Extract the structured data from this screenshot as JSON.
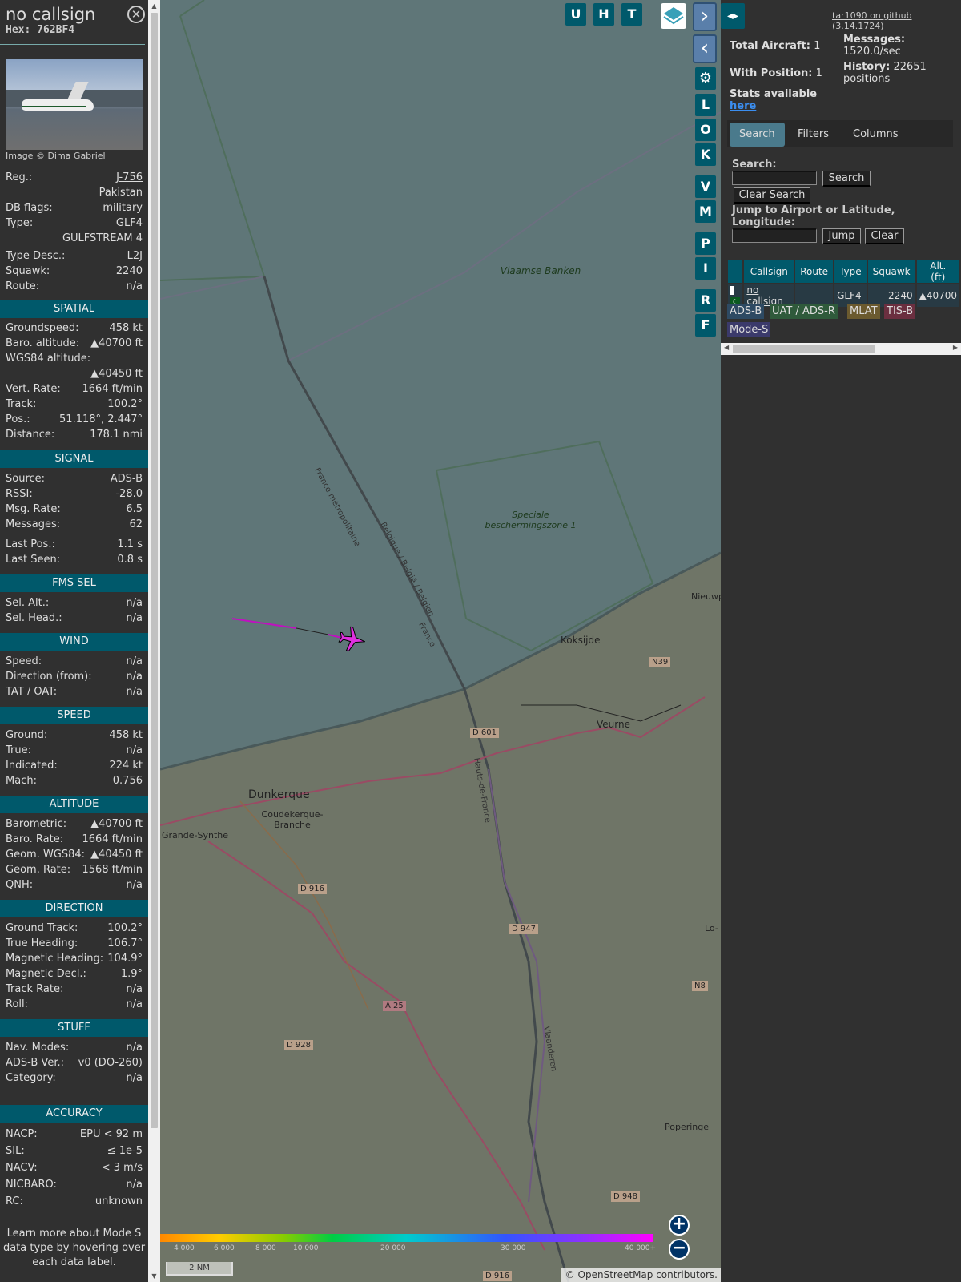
{
  "info": {
    "callsign": "no callsign",
    "hex": "Hex: 762BF4",
    "image_credit": "Image © Dima Gabriel",
    "reg_label": "Reg.:",
    "reg": "J-756",
    "country": "Pakistan",
    "dbflags_label": "DB flags:",
    "dbflags": "military",
    "type_label": "Type:",
    "type": "GLF4",
    "type_full": "GULFSTREAM 4",
    "typedesc_label": "Type Desc.:",
    "typedesc": "L2J",
    "squawk_label": "Squawk:",
    "squawk": "2240",
    "route_label": "Route:",
    "route": "n/a"
  },
  "sections": {
    "spatial": "SPATIAL",
    "signal": "SIGNAL",
    "fms": "FMS SEL",
    "wind": "WIND",
    "speed": "SPEED",
    "altitude": "ALTITUDE",
    "direction": "DIRECTION",
    "stuff": "STUFF",
    "accuracy": "ACCURACY"
  },
  "spatial": [
    [
      "Groundspeed:",
      "458 kt"
    ],
    [
      "Baro. altitude:",
      "▲40700 ft"
    ],
    [
      "WGS84 altitude:",
      ""
    ],
    [
      "",
      "▲40450 ft"
    ],
    [
      "Vert. Rate:",
      "1664 ft/min"
    ],
    [
      "Track:",
      "100.2°"
    ],
    [
      "Pos.:",
      "51.118°, 2.447°"
    ],
    [
      "Distance:",
      "178.1 nmi"
    ]
  ],
  "signal": [
    [
      "Source:",
      "ADS-B"
    ],
    [
      "RSSI:",
      "-28.0"
    ],
    [
      "Msg. Rate:",
      "6.5"
    ],
    [
      "Messages:",
      "62"
    ],
    [
      "Last Pos.:",
      "1.1 s"
    ],
    [
      "Last Seen:",
      "0.8 s"
    ]
  ],
  "fms": [
    [
      "Sel. Alt.:",
      "n/a"
    ],
    [
      "Sel. Head.:",
      "n/a"
    ]
  ],
  "wind": [
    [
      "Speed:",
      "n/a"
    ],
    [
      "Direction (from):",
      "n/a"
    ],
    [
      "TAT / OAT:",
      "n/a"
    ]
  ],
  "speed": [
    [
      "Ground:",
      "458 kt"
    ],
    [
      "True:",
      "n/a"
    ],
    [
      "Indicated:",
      "224 kt"
    ],
    [
      "Mach:",
      "0.756"
    ]
  ],
  "altitude": [
    [
      "Barometric:",
      "▲40700 ft"
    ],
    [
      "Baro. Rate:",
      "1664 ft/min"
    ],
    [
      "Geom. WGS84:",
      "▲40450 ft"
    ],
    [
      "Geom. Rate:",
      "1568 ft/min"
    ],
    [
      "QNH:",
      "n/a"
    ]
  ],
  "direction": [
    [
      "Ground Track:",
      "100.2°"
    ],
    [
      "True Heading:",
      "106.7°"
    ],
    [
      "Magnetic Heading:",
      "104.9°"
    ],
    [
      "Magnetic Decl.:",
      "1.9°"
    ],
    [
      "Track Rate:",
      "n/a"
    ],
    [
      "Roll:",
      "n/a"
    ]
  ],
  "stuff": [
    [
      "Nav. Modes:",
      "n/a"
    ],
    [
      "ADS-B Ver.:",
      "v0 (DO-260)"
    ],
    [
      "Category:",
      "n/a"
    ]
  ],
  "accuracy": [
    [
      "NACP:",
      "EPU < 92 m"
    ],
    [
      "SIL:",
      "≤ 1e-5"
    ],
    [
      "NACV:",
      "< 3 m/s"
    ],
    [
      "NICBARO:",
      "n/a"
    ],
    [
      "RC:",
      "unknown"
    ]
  ],
  "footer": "Learn more about Mode S data type by hovering over each data label.",
  "map": {
    "buttons_top": [
      "U",
      "H",
      "T"
    ],
    "buttons_side": [
      "L",
      "O",
      "K",
      "V",
      "M",
      "P",
      "I",
      "R",
      "F"
    ],
    "labels": {
      "vlaamse": "Vlaamse Banken",
      "speciale": "Speciale beschermingszone 1",
      "koksijde": "Koksijde",
      "veurne": "Veurne",
      "dunkerque": "Dunkerque",
      "coudekerque": "Coudekerque-Branche",
      "grande": "Grande-Synthe",
      "poperinge": "Poperinge",
      "nieuwp": "Nieuwp",
      "lo": "Lo-",
      "d601": "D 601",
      "d916": "D 916",
      "d947": "D 947",
      "a25": "A 25",
      "d928": "D 928",
      "d948": "D 948",
      "d916b": "D 916",
      "n39": "N39",
      "n8": "N8",
      "border1": "France métropolitaine",
      "border2": "Belgique / België / Belgien",
      "border3": "France",
      "hauts": "Hauts-de-France",
      "vlaanderen": "Vlaanderen"
    },
    "colorbar_ticks": [
      "4 000",
      "6 000",
      "8 000",
      "10 000",
      "20 000",
      "30 000",
      "40 000+"
    ],
    "scale": "2 NM",
    "attribution": "© OpenStreetMap contributors."
  },
  "right": {
    "github": "tar1090 on github (3.14.1724)",
    "total_label": "Total Aircraft:",
    "total": "1",
    "withpos_label": "With Position:",
    "withpos": "1",
    "messages_label": "Messages:",
    "messages": "1520.0/sec",
    "history_label": "History:",
    "history": "22651 positions",
    "stats_label": "Stats available",
    "stats_link": "here",
    "tabs": [
      "Search",
      "Filters",
      "Columns"
    ],
    "search_label": "Search:",
    "search_btn": "Search",
    "clear_search_btn": "Clear Search",
    "jump_label": "Jump to Airport or Latitude, Longitude:",
    "jump_btn": "Jump",
    "clear_btn": "Clear",
    "columns": [
      "Callsign",
      "Route",
      "Type",
      "Squawk",
      "Alt. (ft)"
    ],
    "row": {
      "callsign": "no callsign",
      "route": "",
      "type": "GLF4",
      "squawk": "2240",
      "alt": "▲40700"
    },
    "sources": [
      "ADS-B",
      "UAT / ADS-R",
      "MLAT",
      "TIS-B",
      "Mode-S"
    ]
  }
}
